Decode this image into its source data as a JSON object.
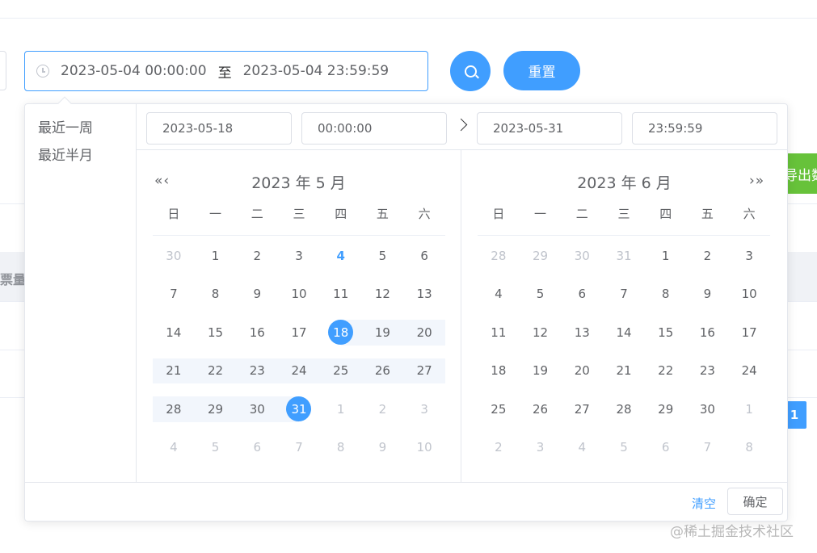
{
  "range_input": {
    "start": "2023-05-04 00:00:00",
    "separator": "至",
    "end": "2023-05-04 23:59:59"
  },
  "buttons": {
    "reset": "重置",
    "export_partial": "导出数"
  },
  "table": {
    "header_fragment": "票量"
  },
  "pagination": {
    "current": "1"
  },
  "picker": {
    "shortcuts": [
      "最近一周",
      "最近半月"
    ],
    "start_date": "2023-05-18",
    "start_time": "00:00:00",
    "end_date": "2023-05-31",
    "end_time": "23:59:59",
    "left": {
      "title": "2023 年 5 月",
      "nav": "«‹"
    },
    "right": {
      "title": "2023 年 6 月",
      "nav": "›»"
    },
    "weekdays": [
      "日",
      "一",
      "二",
      "三",
      "四",
      "五",
      "六"
    ],
    "clear": "清空",
    "confirm": "确定"
  },
  "calendars": {
    "may": [
      {
        "d": "30",
        "s": "other"
      },
      {
        "d": "1",
        "s": ""
      },
      {
        "d": "2",
        "s": ""
      },
      {
        "d": "3",
        "s": ""
      },
      {
        "d": "4",
        "s": "today"
      },
      {
        "d": "5",
        "s": ""
      },
      {
        "d": "6",
        "s": ""
      },
      {
        "d": "7",
        "s": ""
      },
      {
        "d": "8",
        "s": ""
      },
      {
        "d": "9",
        "s": ""
      },
      {
        "d": "10",
        "s": ""
      },
      {
        "d": "11",
        "s": ""
      },
      {
        "d": "12",
        "s": ""
      },
      {
        "d": "13",
        "s": ""
      },
      {
        "d": "14",
        "s": ""
      },
      {
        "d": "15",
        "s": ""
      },
      {
        "d": "16",
        "s": ""
      },
      {
        "d": "17",
        "s": ""
      },
      {
        "d": "18",
        "s": "in-range start"
      },
      {
        "d": "19",
        "s": "in-range"
      },
      {
        "d": "20",
        "s": "in-range"
      },
      {
        "d": "21",
        "s": "in-range"
      },
      {
        "d": "22",
        "s": "in-range"
      },
      {
        "d": "23",
        "s": "in-range"
      },
      {
        "d": "24",
        "s": "in-range"
      },
      {
        "d": "25",
        "s": "in-range"
      },
      {
        "d": "26",
        "s": "in-range"
      },
      {
        "d": "27",
        "s": "in-range"
      },
      {
        "d": "28",
        "s": "in-range"
      },
      {
        "d": "29",
        "s": "in-range"
      },
      {
        "d": "30",
        "s": "in-range"
      },
      {
        "d": "31",
        "s": "in-range end"
      },
      {
        "d": "1",
        "s": "other"
      },
      {
        "d": "2",
        "s": "other"
      },
      {
        "d": "3",
        "s": "other"
      },
      {
        "d": "4",
        "s": "other"
      },
      {
        "d": "5",
        "s": "other"
      },
      {
        "d": "6",
        "s": "other"
      },
      {
        "d": "7",
        "s": "other"
      },
      {
        "d": "8",
        "s": "other"
      },
      {
        "d": "9",
        "s": "other"
      },
      {
        "d": "10",
        "s": "other"
      }
    ],
    "june": [
      {
        "d": "28",
        "s": "other"
      },
      {
        "d": "29",
        "s": "other"
      },
      {
        "d": "30",
        "s": "other"
      },
      {
        "d": "31",
        "s": "other"
      },
      {
        "d": "1",
        "s": ""
      },
      {
        "d": "2",
        "s": ""
      },
      {
        "d": "3",
        "s": ""
      },
      {
        "d": "4",
        "s": ""
      },
      {
        "d": "5",
        "s": ""
      },
      {
        "d": "6",
        "s": ""
      },
      {
        "d": "7",
        "s": ""
      },
      {
        "d": "8",
        "s": ""
      },
      {
        "d": "9",
        "s": ""
      },
      {
        "d": "10",
        "s": ""
      },
      {
        "d": "11",
        "s": ""
      },
      {
        "d": "12",
        "s": ""
      },
      {
        "d": "13",
        "s": ""
      },
      {
        "d": "14",
        "s": ""
      },
      {
        "d": "15",
        "s": ""
      },
      {
        "d": "16",
        "s": ""
      },
      {
        "d": "17",
        "s": ""
      },
      {
        "d": "18",
        "s": ""
      },
      {
        "d": "19",
        "s": ""
      },
      {
        "d": "20",
        "s": ""
      },
      {
        "d": "21",
        "s": ""
      },
      {
        "d": "22",
        "s": ""
      },
      {
        "d": "23",
        "s": ""
      },
      {
        "d": "24",
        "s": ""
      },
      {
        "d": "25",
        "s": ""
      },
      {
        "d": "26",
        "s": ""
      },
      {
        "d": "27",
        "s": ""
      },
      {
        "d": "28",
        "s": ""
      },
      {
        "d": "29",
        "s": ""
      },
      {
        "d": "30",
        "s": ""
      },
      {
        "d": "1",
        "s": "other"
      },
      {
        "d": "2",
        "s": "other"
      },
      {
        "d": "3",
        "s": "other"
      },
      {
        "d": "4",
        "s": "other"
      },
      {
        "d": "5",
        "s": "other"
      },
      {
        "d": "6",
        "s": "other"
      },
      {
        "d": "7",
        "s": "other"
      },
      {
        "d": "8",
        "s": "other"
      }
    ]
  },
  "watermark": "@稀土掘金技术社区",
  "colors": {
    "primary": "#409eff",
    "success": "#67c23a",
    "range_bg": "#f2f6fc",
    "text": "#606266",
    "muted": "#c0c4cc"
  },
  "icons": [
    "clock-icon",
    "search-icon",
    "double-left-icon",
    "single-left-icon",
    "arrow-right-icon",
    "single-right-icon",
    "double-right-icon"
  ]
}
